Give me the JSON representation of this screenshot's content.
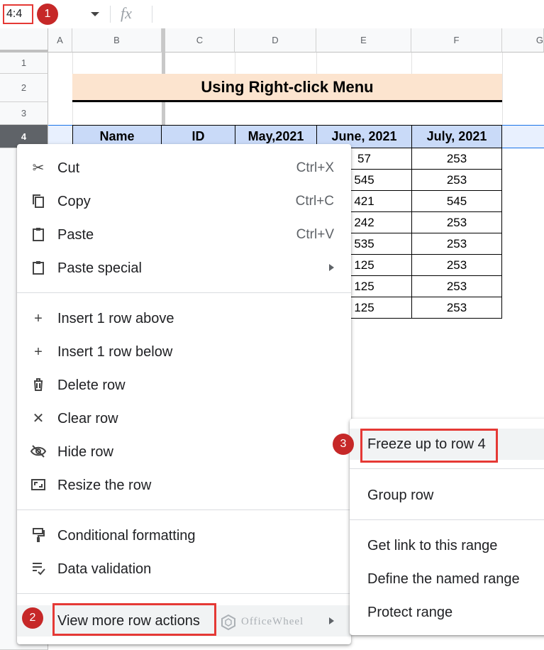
{
  "formula_bar": {
    "name_box": "4:4",
    "fx": "fx"
  },
  "badges": {
    "step1": "1",
    "step2": "2",
    "step3": "3"
  },
  "columns": [
    "A",
    "B",
    "C",
    "D",
    "E",
    "F",
    "G"
  ],
  "rows": [
    "1",
    "2",
    "3",
    "4"
  ],
  "sheet": {
    "title": "Using Right-click Menu",
    "headers": [
      "Name",
      "ID",
      "May,2021",
      "June, 2021",
      "July, 2021"
    ],
    "june_values": [
      "57",
      "545",
      "421",
      "242",
      "535",
      "125",
      "125",
      "125"
    ],
    "july_values": [
      "253",
      "253",
      "545",
      "253",
      "253",
      "253",
      "253",
      "253"
    ]
  },
  "context_menu": {
    "cut": {
      "label": "Cut",
      "shortcut": "Ctrl+X"
    },
    "copy": {
      "label": "Copy",
      "shortcut": "Ctrl+C"
    },
    "paste": {
      "label": "Paste",
      "shortcut": "Ctrl+V"
    },
    "paste_special": {
      "label": "Paste special"
    },
    "insert_above": {
      "label": "Insert 1 row above"
    },
    "insert_below": {
      "label": "Insert 1 row below"
    },
    "delete_row": {
      "label": "Delete row"
    },
    "clear_row": {
      "label": "Clear row"
    },
    "hide_row": {
      "label": "Hide row"
    },
    "resize_row": {
      "label": "Resize the row"
    },
    "conditional_formatting": {
      "label": "Conditional formatting"
    },
    "data_validation": {
      "label": "Data validation"
    },
    "more_row_actions": {
      "label": "View more row actions"
    }
  },
  "submenu": {
    "freeze": "Freeze up to row 4",
    "group": "Group row",
    "get_link": "Get link to this range",
    "define_named": "Define the named range",
    "protect": "Protect range"
  },
  "watermark": "OfficeWheel",
  "colors": {
    "highlight": "#e53935",
    "badge": "#c62828",
    "title_fill": "#fce4cf",
    "header_fill": "#c9daf8"
  }
}
